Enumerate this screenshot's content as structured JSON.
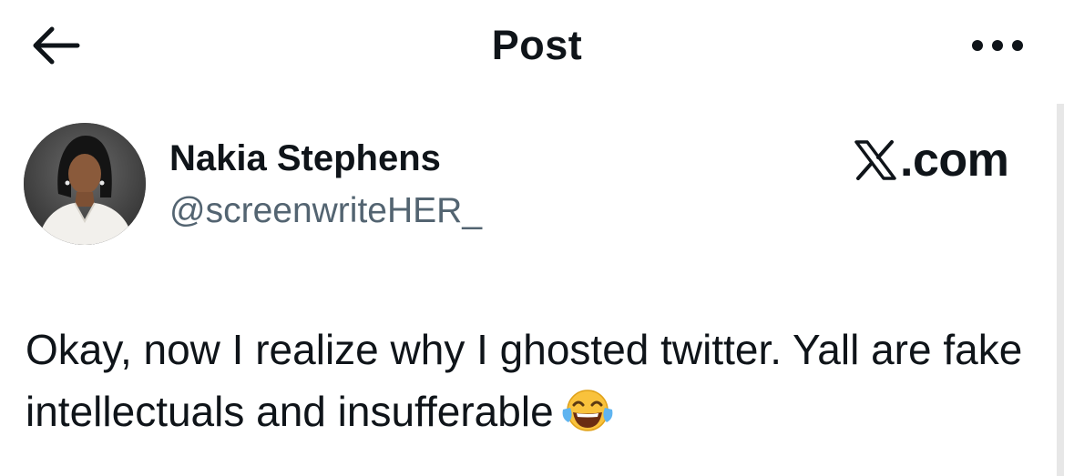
{
  "header": {
    "title": "Post",
    "back_icon": "arrow-left-icon",
    "more_icon": "more-horizontal-icon"
  },
  "post": {
    "author_name": "Nakia Stephens",
    "author_handle": "@screenwriteHER_",
    "watermark": ".com",
    "text": "Okay, now I realize why I ghosted twitter. Yall are fake intellectuals and insufferable",
    "emoji": "face-with-tears-of-joy-icon"
  },
  "colors": {
    "text_primary": "#0f1419",
    "text_secondary": "#536471",
    "background": "#ffffff"
  }
}
